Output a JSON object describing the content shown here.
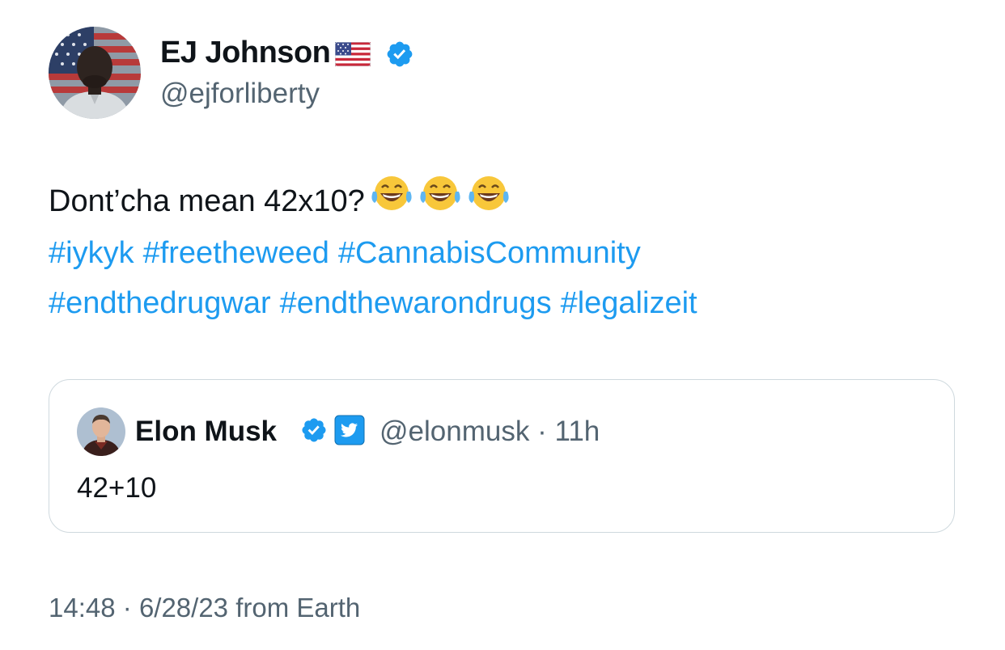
{
  "author": {
    "name": "EJ Johnson",
    "handle": "@ejforliberty",
    "flag_icon": "us-flag-icon",
    "verified_icon": "verified-badge-icon"
  },
  "tweet": {
    "text": "Dont’cha mean 42x10?",
    "emoji": [
      "face-with-tears-of-joy-icon",
      "face-with-tears-of-joy-icon",
      "face-with-tears-of-joy-icon"
    ],
    "hashtags_line1": [
      "#iykyk",
      "#freetheweed",
      "#CannabisCommunity"
    ],
    "hashtags_line2": [
      "#endthedrugwar",
      "#endthewarondrugs",
      "#legalizeit"
    ]
  },
  "quote": {
    "name": "Elon Musk",
    "handle": "@elonmusk",
    "separator": "·",
    "time": "11h",
    "text": "42+10",
    "verified_icon": "verified-badge-icon",
    "affiliate_icon": "twitter-affiliate-badge-icon"
  },
  "footer": {
    "time": "14:48",
    "separator": "·",
    "date": "6/28/23",
    "source": "from Earth"
  },
  "colors": {
    "link": "#1d9bf0",
    "secondary_text": "#536471",
    "border": "#cfd9de",
    "text": "#0f1419"
  }
}
